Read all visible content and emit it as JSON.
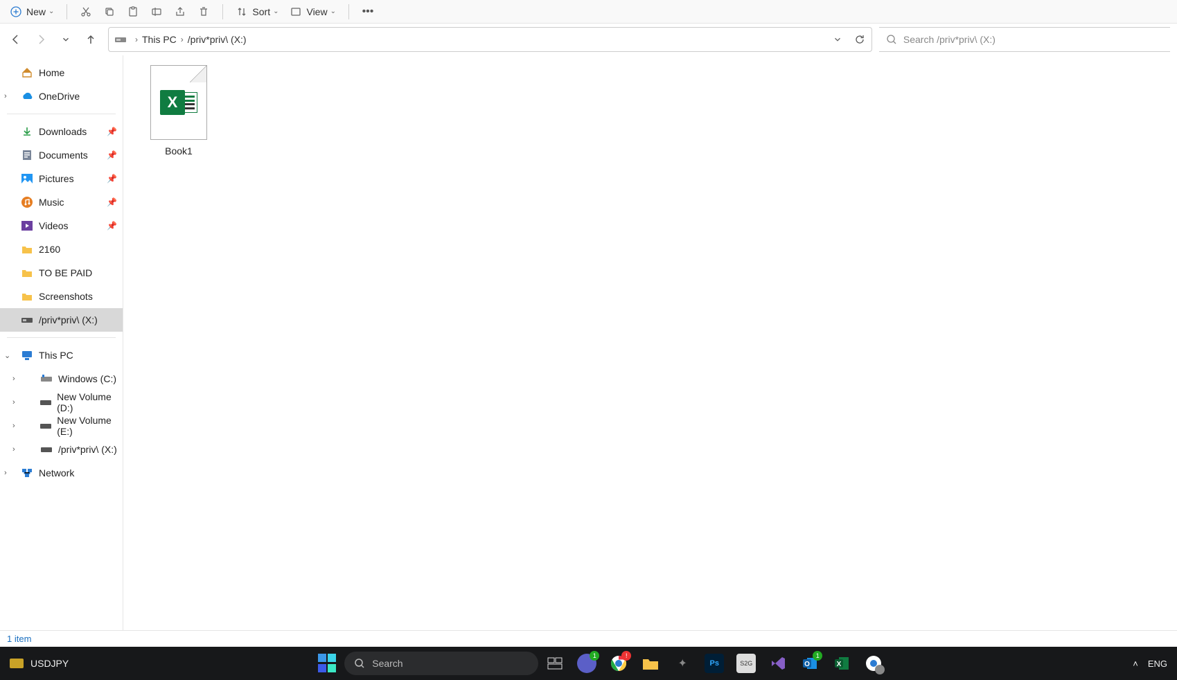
{
  "toolbar": {
    "new_label": "New",
    "sort_label": "Sort",
    "view_label": "View"
  },
  "breadcrumb": {
    "item0": "This PC",
    "item1": "/priv*priv\\ (X:)"
  },
  "search": {
    "placeholder": "Search /priv*priv\\ (X:)"
  },
  "sidebar": {
    "home": "Home",
    "onedrive": "OneDrive",
    "quick": {
      "downloads": "Downloads",
      "documents": "Documents",
      "pictures": "Pictures",
      "music": "Music",
      "videos": "Videos",
      "f_2160": "2160",
      "f_tobepaid": "TO BE PAID",
      "f_screenshots": "Screenshots",
      "drive_x": "/priv*priv\\ (X:)"
    },
    "thispc": "This PC",
    "drives": {
      "c": "Windows (C:)",
      "d": "New Volume (D:)",
      "e": "New Volume (E:)",
      "x": "/priv*priv\\ (X:)"
    },
    "network": "Network"
  },
  "files": {
    "item0": "Book1"
  },
  "status": {
    "count": "1 item"
  },
  "taskbar": {
    "ticker": "USDJPY",
    "search_placeholder": "Search",
    "lang": "ENG",
    "badge_chrome": "!",
    "badge_teams": "1"
  }
}
